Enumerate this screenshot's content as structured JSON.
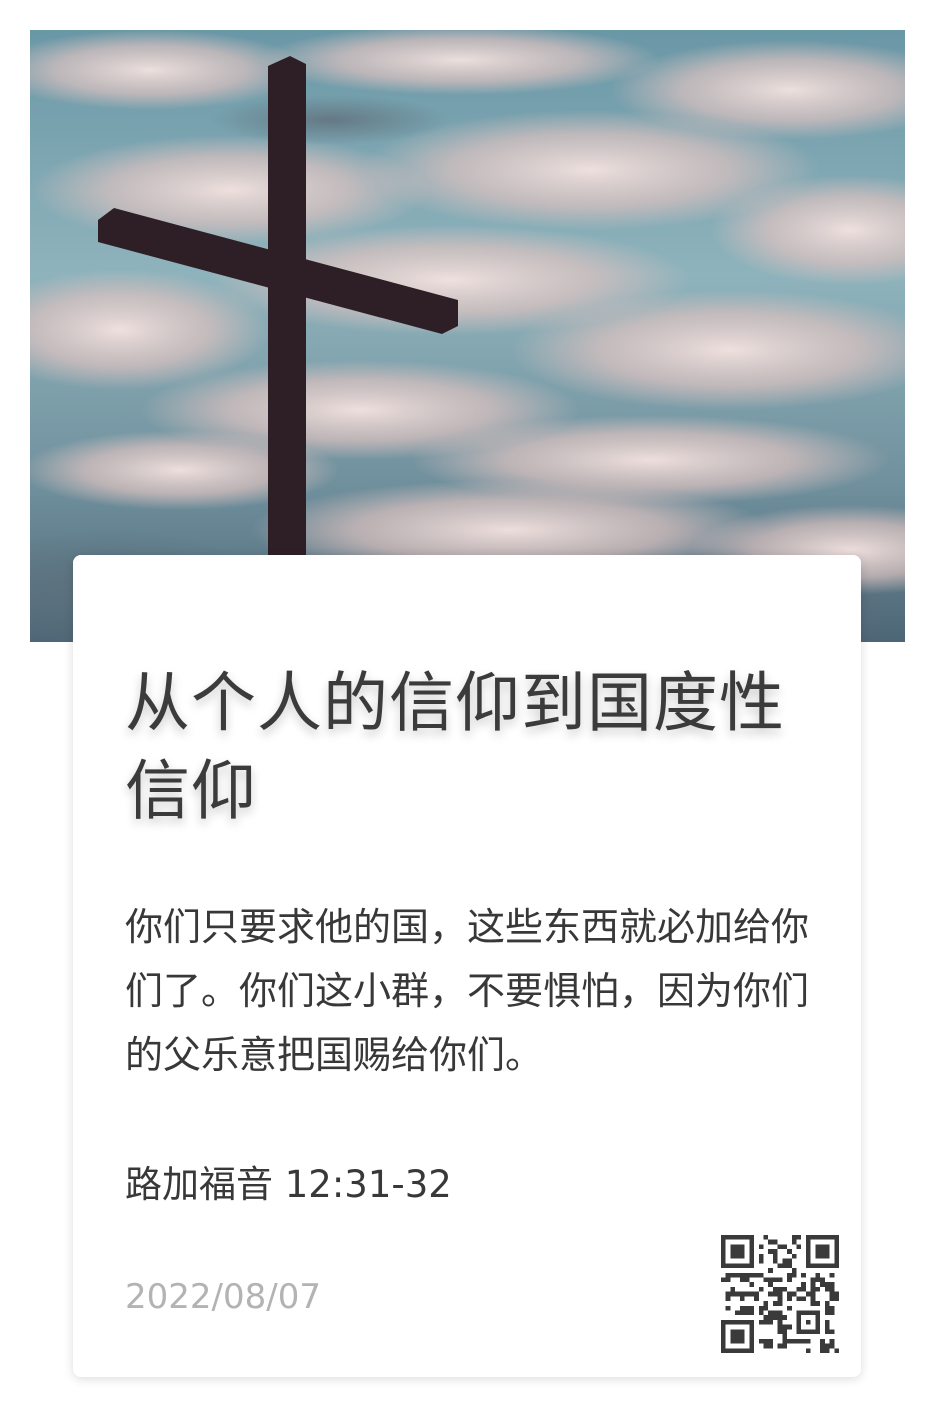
{
  "card": {
    "title": "从个人的信仰到国度性信仰",
    "verse": "你们只要求他的国，这些东西就必加给你们了。你们这小群，不要惧怕，因为你们的父乐意把国赐给你们。",
    "reference": "路加福音 12:31-32",
    "date": "2022/08/07"
  },
  "hero": {
    "subject": "cross-silhouette",
    "colors": {
      "sky": "#7fa6b2",
      "cloud": "#e8d2d0",
      "cross": "#2e1f26"
    }
  },
  "qr": {
    "icon": "qr-code-icon",
    "color": "#3a3a3a"
  }
}
